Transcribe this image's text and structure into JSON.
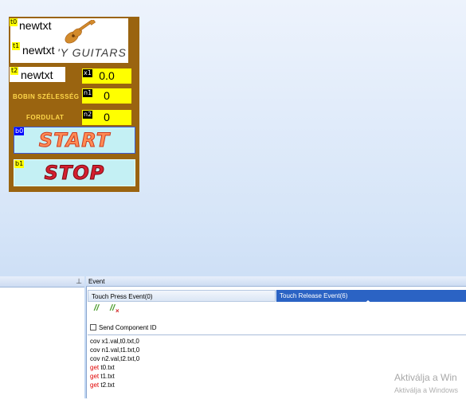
{
  "hmi": {
    "t0": {
      "id": "t0",
      "text": "newtxt"
    },
    "t1": {
      "id": "t1",
      "text": "newtxt"
    },
    "t2": {
      "id": "t2",
      "text": "newtxt"
    },
    "brand": "'Y GUITARS",
    "x1": {
      "id": "x1",
      "value": "0.0"
    },
    "n1": {
      "id": "n1",
      "value": "0",
      "label": "BOBIN SZÉLESSÉG"
    },
    "n2": {
      "id": "n2",
      "value": "0",
      "label": "FORDULAT"
    },
    "b0": {
      "id": "b0",
      "label": "START"
    },
    "b1": {
      "id": "b1",
      "label": "STOP"
    }
  },
  "left_panel": {
    "pin": "⊥"
  },
  "event_panel": {
    "title": "Event",
    "tabs": [
      "Touch Press Event(0)",
      "Touch Release Event(6)"
    ],
    "active_tab": 1,
    "toolbar": [
      "comment-icon",
      "uncomment-icon"
    ],
    "send_component_id_label": "Send Component ID",
    "send_component_id_checked": false,
    "code": [
      {
        "text": "cov x1.val,t0.txt,0",
        "color": "#000000"
      },
      {
        "text": "cov n1.val,t1.txt,0",
        "color": "#000000"
      },
      {
        "text": "cov n2.val,t2.txt,0",
        "color": "#000000"
      },
      {
        "kw": "get",
        "text": " t0.txt",
        "color": "#000000",
        "kw_color": "#e00000"
      },
      {
        "kw": "get",
        "text": " t1.txt",
        "color": "#000000",
        "kw_color": "#e00000"
      },
      {
        "kw": "get",
        "text": " t2.txt",
        "color": "#000000",
        "kw_color": "#e00000"
      }
    ]
  },
  "watermark": {
    "line1": "Aktiválja a Win",
    "line2": "Aktiválja a Windows"
  },
  "colors": {
    "panel_bg": "#9a6410",
    "yellow": "#ffff00",
    "active_tab": "#2b63c4",
    "button_bg": "#c4f0f4"
  }
}
